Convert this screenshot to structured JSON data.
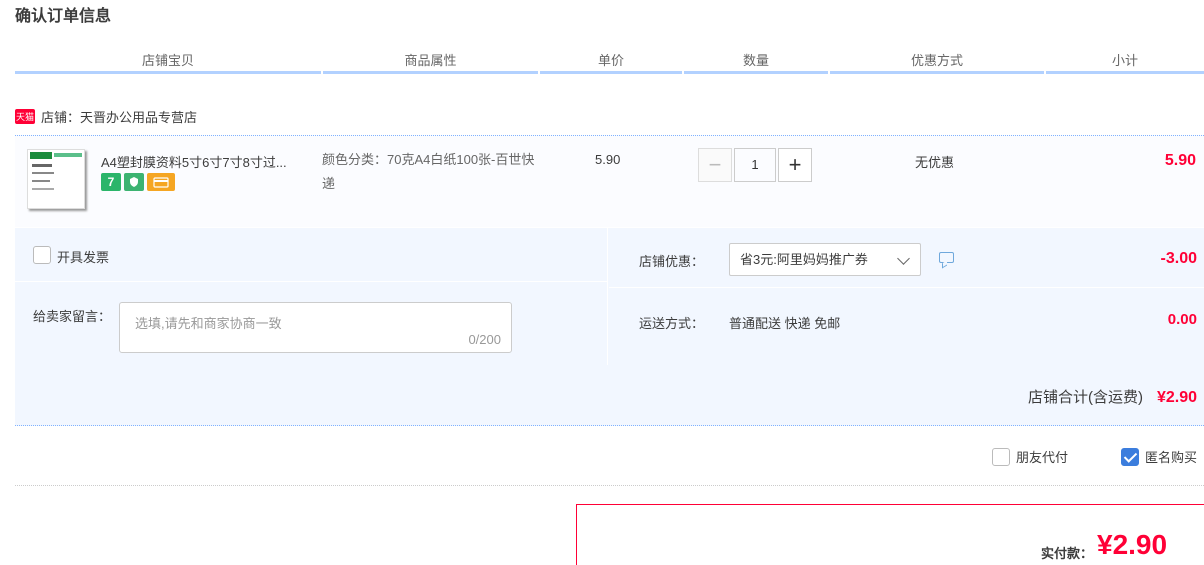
{
  "page": {
    "title": "确认订单信息"
  },
  "columns": [
    "店铺宝贝",
    "商品属性",
    "单价",
    "数量",
    "优惠方式",
    "小计"
  ],
  "shop": {
    "badge": "天猫",
    "label": "店铺：天晋办公用品专营店"
  },
  "item": {
    "title": "A4塑封膜资料5寸6寸7寸8寸过...",
    "attributes": "颜色分类：70克A4白纸100张-百世快递",
    "unit_price": "5.90",
    "quantity": "1",
    "qty_minus": "−",
    "qty_plus": "+",
    "discount": "无优惠",
    "subtotal": "5.90",
    "badges": [
      "7",
      "",
      ""
    ]
  },
  "invoice": {
    "label": "开具发票",
    "checked": false
  },
  "memo": {
    "label": "给卖家留言：",
    "placeholder": "选填,请先和商家协商一致",
    "count": "0/200"
  },
  "promotion": {
    "label": "店铺优惠：",
    "selected": "省3元:阿里妈妈推广券",
    "amount": "-3.00"
  },
  "shipping": {
    "label": "运送方式：",
    "value": "普通配送 快递 免邮",
    "amount": "0.00"
  },
  "shop_total": {
    "label": "店铺合计(含运费)",
    "amount": "¥2.90"
  },
  "options": {
    "friend_pay": {
      "label": "朋友代付",
      "checked": false
    },
    "anonymous": {
      "label": "匿名购买",
      "checked": true
    }
  },
  "payment": {
    "label": "实付款：",
    "amount": "¥2.90"
  },
  "colors": {
    "accent": "#ff0036",
    "header_border": "#b2d1ff",
    "panel_bg": "#f2f7ff",
    "checkbox_checked": "#3b7ddd"
  }
}
